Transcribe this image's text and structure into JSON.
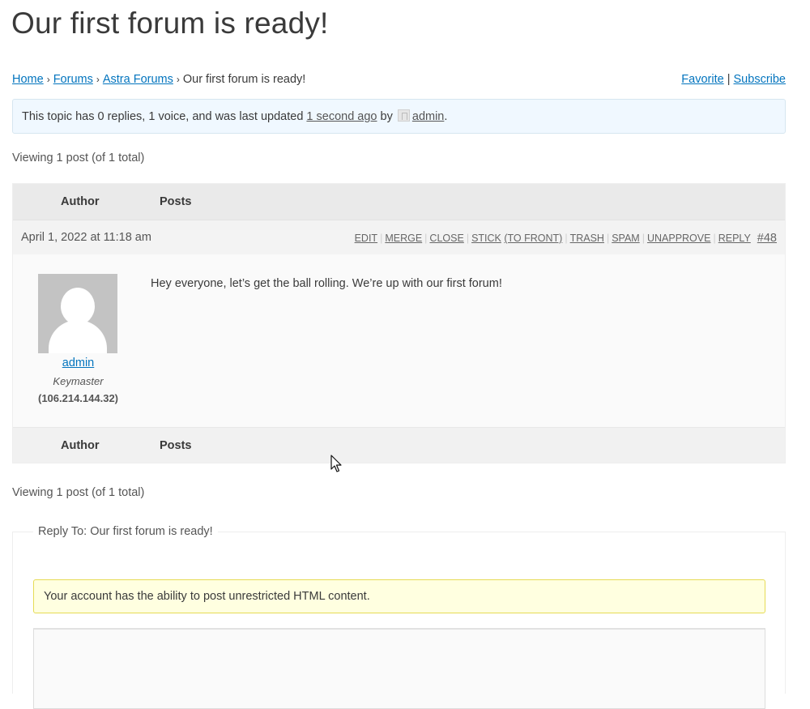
{
  "page": {
    "title": "Our first forum is ready!"
  },
  "breadcrumb": {
    "items": [
      {
        "label": "Home",
        "link": true
      },
      {
        "label": "Forums",
        "link": true
      },
      {
        "label": "Astra Forums",
        "link": true
      },
      {
        "label": "Our first forum is ready!",
        "link": false
      }
    ],
    "separator": "›"
  },
  "topic_actions": {
    "favorite": "Favorite",
    "separator": "|",
    "subscribe": "Subscribe"
  },
  "topic_info": {
    "prefix": "This topic has 0 replies, 1 voice, and was last updated ",
    "time_link": "1 second ago",
    "by": " by ",
    "user": "admin",
    "suffix": "."
  },
  "pagination": {
    "count_top": "Viewing 1 post (of 1 total)",
    "count_bottom": "Viewing 1 post (of 1 total)"
  },
  "table": {
    "col_author": "Author",
    "col_posts": "Posts"
  },
  "post": {
    "date": "April 1, 2022 at 11:18 am",
    "admin_links": [
      "EDIT",
      "MERGE",
      "CLOSE",
      "STICK",
      "(TO FRONT)",
      "TRASH",
      "SPAM",
      "UNAPPROVE",
      "REPLY"
    ],
    "permalink": "#48",
    "author": {
      "name": "admin",
      "role": "Keymaster",
      "ip": "(106.214.144.32)",
      "avatar_icon": "default-avatar-icon"
    },
    "content": "Hey everyone, let’s get the ball rolling. We’re up with our first forum!"
  },
  "reply_form": {
    "legend": "Reply To: Our first forum is ready!",
    "notice": "Your account has the ability to post unrestricted HTML content.",
    "textarea_value": ""
  },
  "colors": {
    "link": "#0274be",
    "info_bg": "#f0f8ff",
    "notice_bg": "#ffffe0",
    "notice_border": "#e6db55"
  }
}
